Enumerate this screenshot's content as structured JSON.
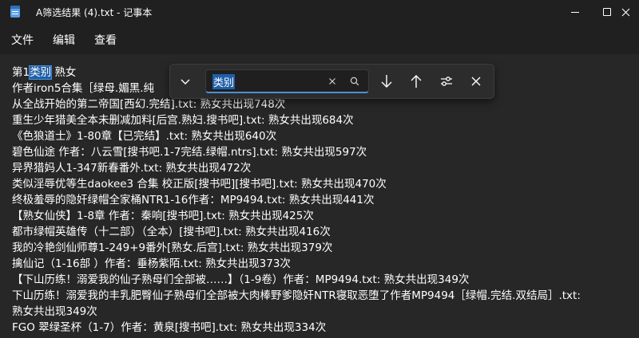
{
  "window": {
    "title": "A筛选结果 (4).txt - 记事本"
  },
  "menu": {
    "items": [
      {
        "label": "文件"
      },
      {
        "label": "编辑"
      },
      {
        "label": "查看"
      }
    ]
  },
  "find": {
    "query": "类别"
  },
  "editor": {
    "first_line": {
      "pre": "第1",
      "match": "类别",
      "post": " 熟女"
    },
    "lines": [
      "作者iron5合集［绿母.媚黑.纯",
      "从全战开始的第二帝国[西幻.完结].txt: 熟女共出现748次",
      "重生少年猎美全本未删减加料[后宫.熟妇.搜书吧].txt: 熟女共出现684次",
      "《色狼道士》1-80章【已完结】.txt: 熟女共出现640次",
      "碧色仙途 作者：八云雪[搜书吧.1-7完结.绿帽.ntrs].txt: 熟女共出现597次",
      "异界猎妈人1-347新春番外.txt: 熟女共出现472次",
      "类似淫辱优等生daokee3 合集 校正版[搜书吧][搜书吧].txt: 熟女共出现470次",
      "终极羞辱的隐奸绿帽全家桶NTR1-16作者：MP9494.txt: 熟女共出现441次",
      "【熟女仙侠】1-8章 作者：秦响[搜书吧].txt: 熟女共出现425次",
      "都市绿帽英雄传（十二部）（全本）[搜书吧].txt: 熟女共出现416次",
      "我的冷艳剑仙师尊1-249+9番外[熟女.后宫].txt: 熟女共出现379次",
      "擒仙记（1-16部 ）作者：垂杨紫陌.txt: 熟女共出现373次",
      "【下山历练！溺爱我的仙子熟母们全部被……】（1-9卷）作者：MP9494.txt: 熟女共出现349次",
      "下山历练！溺爱我的丰乳肥臀仙子熟母们全部被大肉棒野爹隐奸NTR寝取恶堕了作者MP9494［绿帽.完结.双结局］.txt:",
      "熟女共出现349次",
      "FGO 翠绿圣杯（1-7）作者：黄泉[搜书吧].txt: 熟女共出现334次"
    ]
  },
  "colors": {
    "background": "#202020",
    "editor_background": "#272727",
    "selection": "#1f5fa8",
    "accent": "#4c8fd6"
  },
  "icons": {
    "app": "notepad-icon",
    "minimize": "minimize-icon",
    "maximize": "maximize-icon",
    "close": "close-icon",
    "find_toggle": "chevron-down-icon",
    "clear": "clear-icon",
    "search": "search-icon",
    "next": "arrow-down-icon",
    "prev": "arrow-up-icon",
    "options": "options-icon",
    "close_find": "close-icon"
  }
}
